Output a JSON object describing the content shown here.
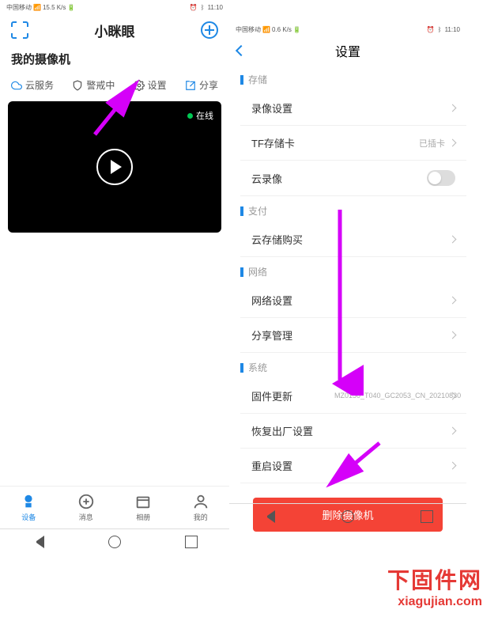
{
  "left": {
    "status": {
      "carrier": "中国移动",
      "speed": "15.5 K/s",
      "time": "11:10"
    },
    "header": {
      "title": "小眯眼"
    },
    "camera_section": "我的摄像机",
    "actions": {
      "cloud": "云服务",
      "alarm": "警戒中",
      "settings": "设置",
      "share": "分享"
    },
    "video": {
      "status": "在线"
    },
    "nav": {
      "devices": "设备",
      "messages": "消息",
      "album": "相册",
      "mine": "我的"
    }
  },
  "right": {
    "status": {
      "carrier": "中国移动",
      "speed": "0.6 K/s",
      "time": "11:10"
    },
    "title": "设置",
    "sections": {
      "storage": {
        "header": "存储",
        "record": "录像设置",
        "tfcard": "TF存储卡",
        "tfcard_val": "已插卡",
        "cloud_rec": "云录像"
      },
      "payment": {
        "header": "支付",
        "buy": "云存储购买"
      },
      "network": {
        "header": "网络",
        "net_settings": "网络设置",
        "share_mgmt": "分享管理"
      },
      "system": {
        "header": "系统",
        "firmware": "固件更新",
        "firmware_val": "MZ0150_T040_GC2053_CN_20210830",
        "factory": "恢复出厂设置",
        "restart": "重启设置"
      }
    },
    "delete": "删除摄像机"
  },
  "watermark": {
    "cn": "下固件网",
    "en": "xiagujian.com"
  }
}
